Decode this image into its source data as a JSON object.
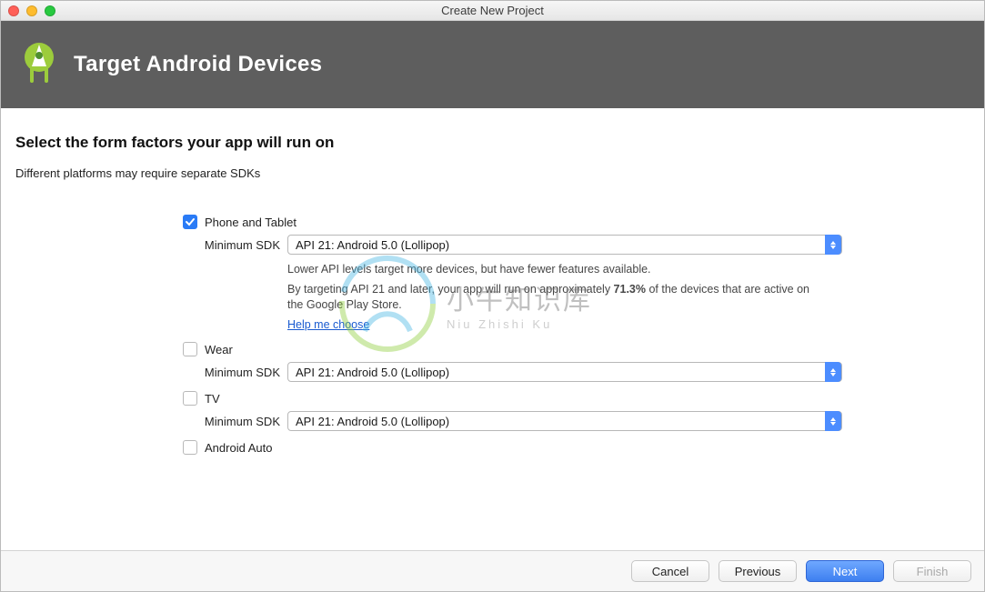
{
  "window": {
    "title": "Create New Project"
  },
  "header": {
    "title": "Target Android Devices"
  },
  "main": {
    "heading": "Select the form factors your app will run on",
    "subhead": "Different platforms may require separate SDKs",
    "sdk_label": "Minimum SDK",
    "helper_lines": {
      "line1": "Lower API levels target more devices, but have fewer features available.",
      "line2a": "By targeting API 21 and later, your app will run on approximately ",
      "pct": "71.3%",
      "line2b": " of the devices that are active on the Google Play Store.",
      "help_link": "Help me choose"
    },
    "factors": {
      "phone": {
        "label": "Phone and Tablet",
        "sdk": "API 21: Android 5.0 (Lollipop)"
      },
      "wear": {
        "label": "Wear",
        "sdk": "API 21: Android 5.0 (Lollipop)"
      },
      "tv": {
        "label": "TV",
        "sdk": "API 21: Android 5.0 (Lollipop)"
      },
      "auto": {
        "label": "Android Auto"
      }
    }
  },
  "footer": {
    "cancel": "Cancel",
    "previous": "Previous",
    "next": "Next",
    "finish": "Finish"
  },
  "watermark": {
    "text": "小牛知识库",
    "sub": "Niu Zhishi Ku"
  }
}
